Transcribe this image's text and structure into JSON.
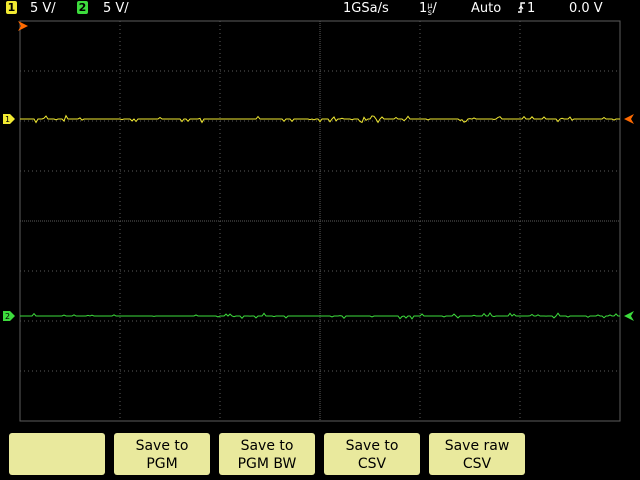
{
  "status_bar": {
    "channels": [
      {
        "badge": "1",
        "scale": "5 V/",
        "color": "#f2ea32"
      },
      {
        "badge": "2",
        "scale": "5 V/",
        "color": "#3ddc3d"
      }
    ],
    "sample_rate": "1GSa/s",
    "timebase": {
      "main": "1",
      "num": "µ",
      "den": "s",
      "suffix": "/"
    },
    "trigger_mode": "Auto",
    "trigger_source": "1",
    "trigger_level": "0.0 V"
  },
  "screen": {
    "grid_color": "#5b5b5b",
    "trigger_marker_color": "#ff6a00",
    "channel_markers": [
      {
        "label": "1",
        "color": "#f2ea32"
      },
      {
        "label": "2",
        "color": "#3ddc3d"
      }
    ]
  },
  "softkeys": [
    {
      "line1": "",
      "line2": ""
    },
    {
      "line1": "Save to",
      "line2": "PGM"
    },
    {
      "line1": "Save to",
      "line2": "PGM BW"
    },
    {
      "line1": "Save to",
      "line2": "CSV"
    },
    {
      "line1": "Save raw",
      "line2": "CSV"
    }
  ]
}
